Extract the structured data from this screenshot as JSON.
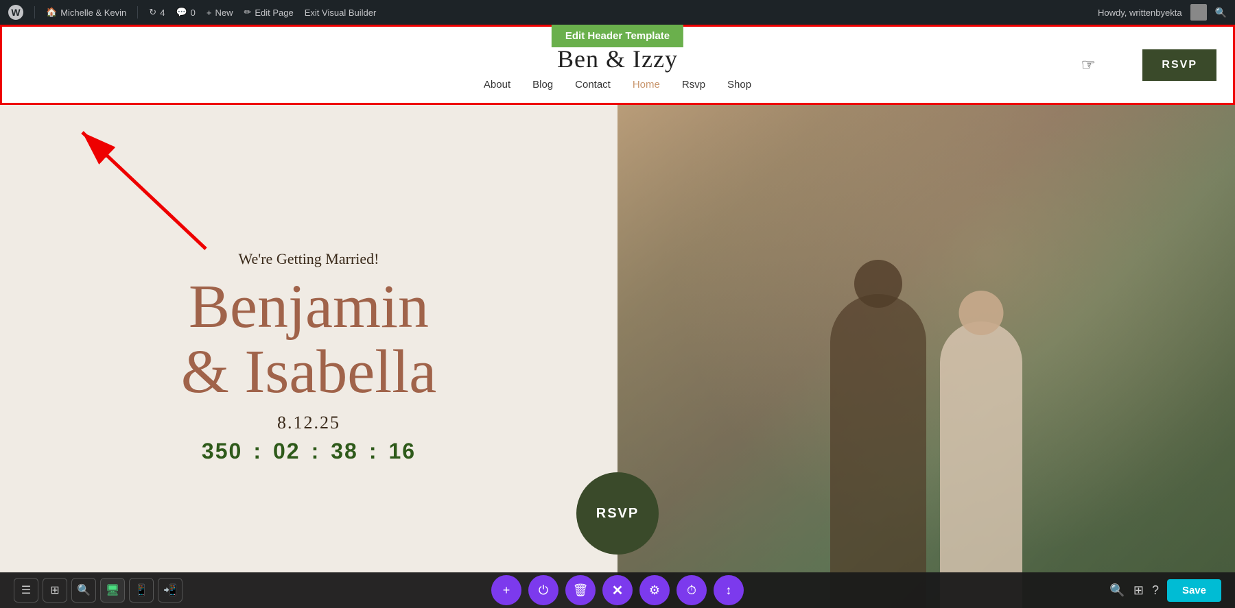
{
  "admin_bar": {
    "site_name": "Michelle & Kevin",
    "updates_count": "4",
    "comments_count": "0",
    "new_label": "New",
    "edit_page_label": "Edit Page",
    "exit_builder_label": "Exit Visual Builder",
    "howdy_text": "Howdy, writtenbyekta"
  },
  "header": {
    "edit_header_btn_label": "Edit Header Template",
    "site_title": "Ben & Izzy",
    "nav_items": [
      {
        "label": "About",
        "active": false
      },
      {
        "label": "Blog",
        "active": false
      },
      {
        "label": "Contact",
        "active": false
      },
      {
        "label": "Home",
        "active": true
      },
      {
        "label": "Rsvp",
        "active": false
      },
      {
        "label": "Shop",
        "active": false
      }
    ],
    "rsvp_btn_label": "RSVP"
  },
  "hero": {
    "subtitle": "We're Getting Married!",
    "name_line1": "Benjamin",
    "name_line2": "& Isabella",
    "date": "8.12.25",
    "countdown": {
      "days": "350",
      "hours": "02",
      "minutes": "38",
      "seconds": "16"
    },
    "rsvp_circle_label": "RSVP"
  },
  "toolbar": {
    "left_icons": [
      "☰",
      "⊞",
      "🔍",
      "🖥",
      "📱",
      "📲"
    ],
    "center_icons": [
      {
        "symbol": "+",
        "type": "purple",
        "label": "add"
      },
      {
        "symbol": "⏻",
        "type": "purple",
        "label": "power"
      },
      {
        "symbol": "🗑",
        "type": "purple",
        "label": "delete"
      },
      {
        "symbol": "✕",
        "type": "close-x",
        "label": "close"
      },
      {
        "symbol": "⚙",
        "type": "purple",
        "label": "settings"
      },
      {
        "symbol": "⏱",
        "type": "purple",
        "label": "history"
      },
      {
        "symbol": "↕",
        "type": "purple",
        "label": "resize"
      }
    ],
    "right_icons": [
      "🔍",
      "⊞",
      "?"
    ],
    "save_label": "Save"
  }
}
